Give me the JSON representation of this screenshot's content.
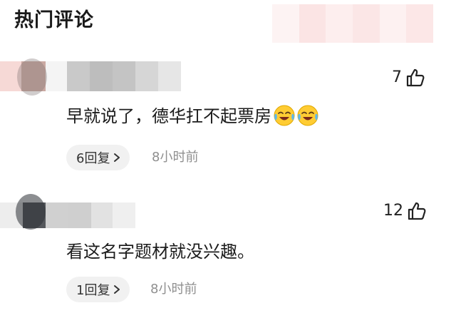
{
  "section_title": "热门评论",
  "comments": [
    {
      "likes": "7",
      "text": "早就说了，德华扛不起票房",
      "emojis": [
        "crying-laughing-emoji",
        "crying-laughing-emoji"
      ],
      "replies_label": "6回复",
      "time": "8小时前"
    },
    {
      "likes": "12",
      "text": "看这名字题材就没兴趣。",
      "emojis": [],
      "replies_label": "1回复",
      "time": "8小时前"
    }
  ],
  "icons": {
    "like": "thumbs-up-icon",
    "reply_chevron": "chevron-right-icon"
  },
  "colors": {
    "reply_pill_bg": "#f1f1f1",
    "time_text": "#8f8f8f",
    "primary_text": "#1c1c1c"
  }
}
